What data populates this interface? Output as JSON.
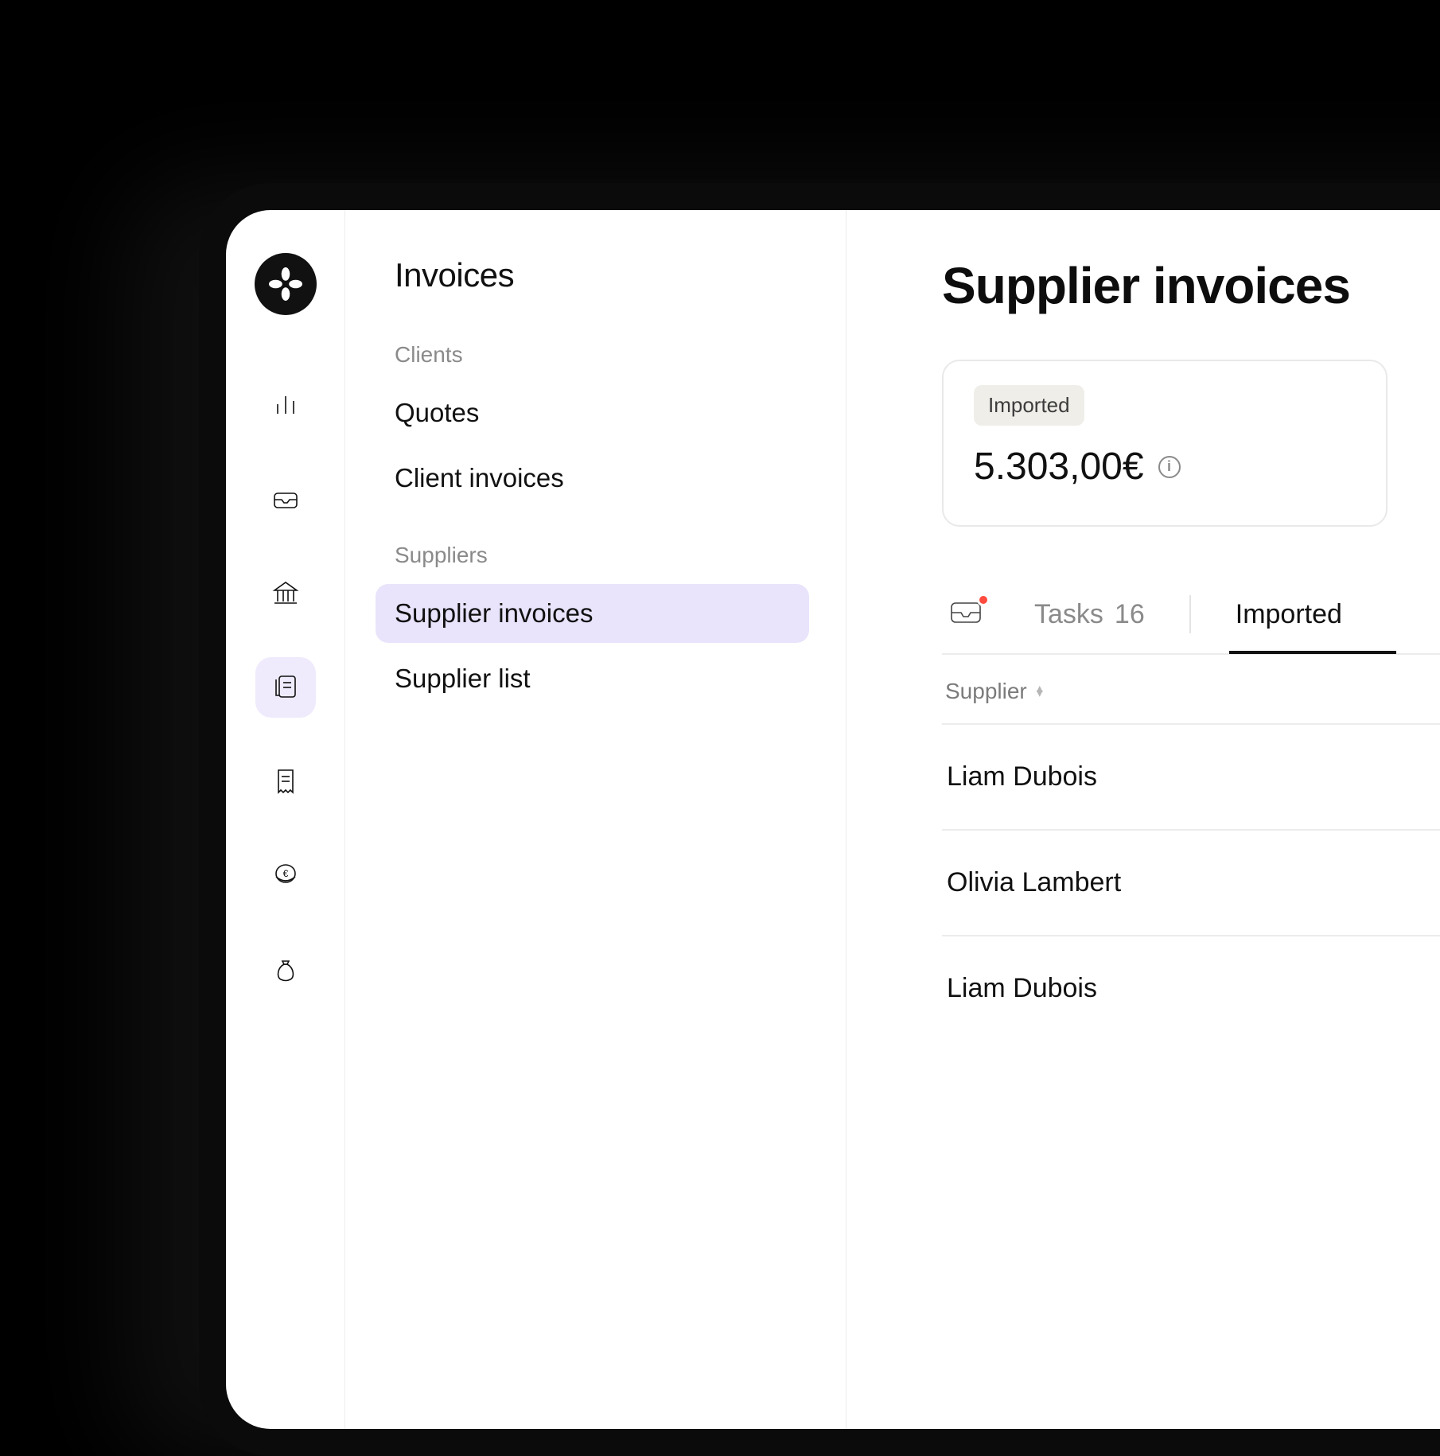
{
  "subnav": {
    "title": "Invoices",
    "groups": [
      {
        "label": "Clients",
        "items": [
          {
            "label": "Quotes",
            "name": "nav-quotes",
            "active": false
          },
          {
            "label": "Client invoices",
            "name": "nav-client-invoices",
            "active": false
          }
        ]
      },
      {
        "label": "Suppliers",
        "items": [
          {
            "label": "Supplier invoices",
            "name": "nav-supplier-invoices",
            "active": true
          },
          {
            "label": "Supplier list",
            "name": "nav-supplier-list",
            "active": false
          }
        ]
      }
    ]
  },
  "main": {
    "title": "Supplier invoices",
    "summary": {
      "chip": "Imported",
      "amount": "5.303,00€"
    },
    "tabs": {
      "tasks_label": "Tasks",
      "tasks_count": "16",
      "imported_label": "Imported"
    },
    "table": {
      "column_supplier": "Supplier",
      "rows": [
        {
          "supplier": "Liam Dubois"
        },
        {
          "supplier": "Olivia Lambert"
        },
        {
          "supplier": "Liam Dubois"
        }
      ]
    }
  }
}
